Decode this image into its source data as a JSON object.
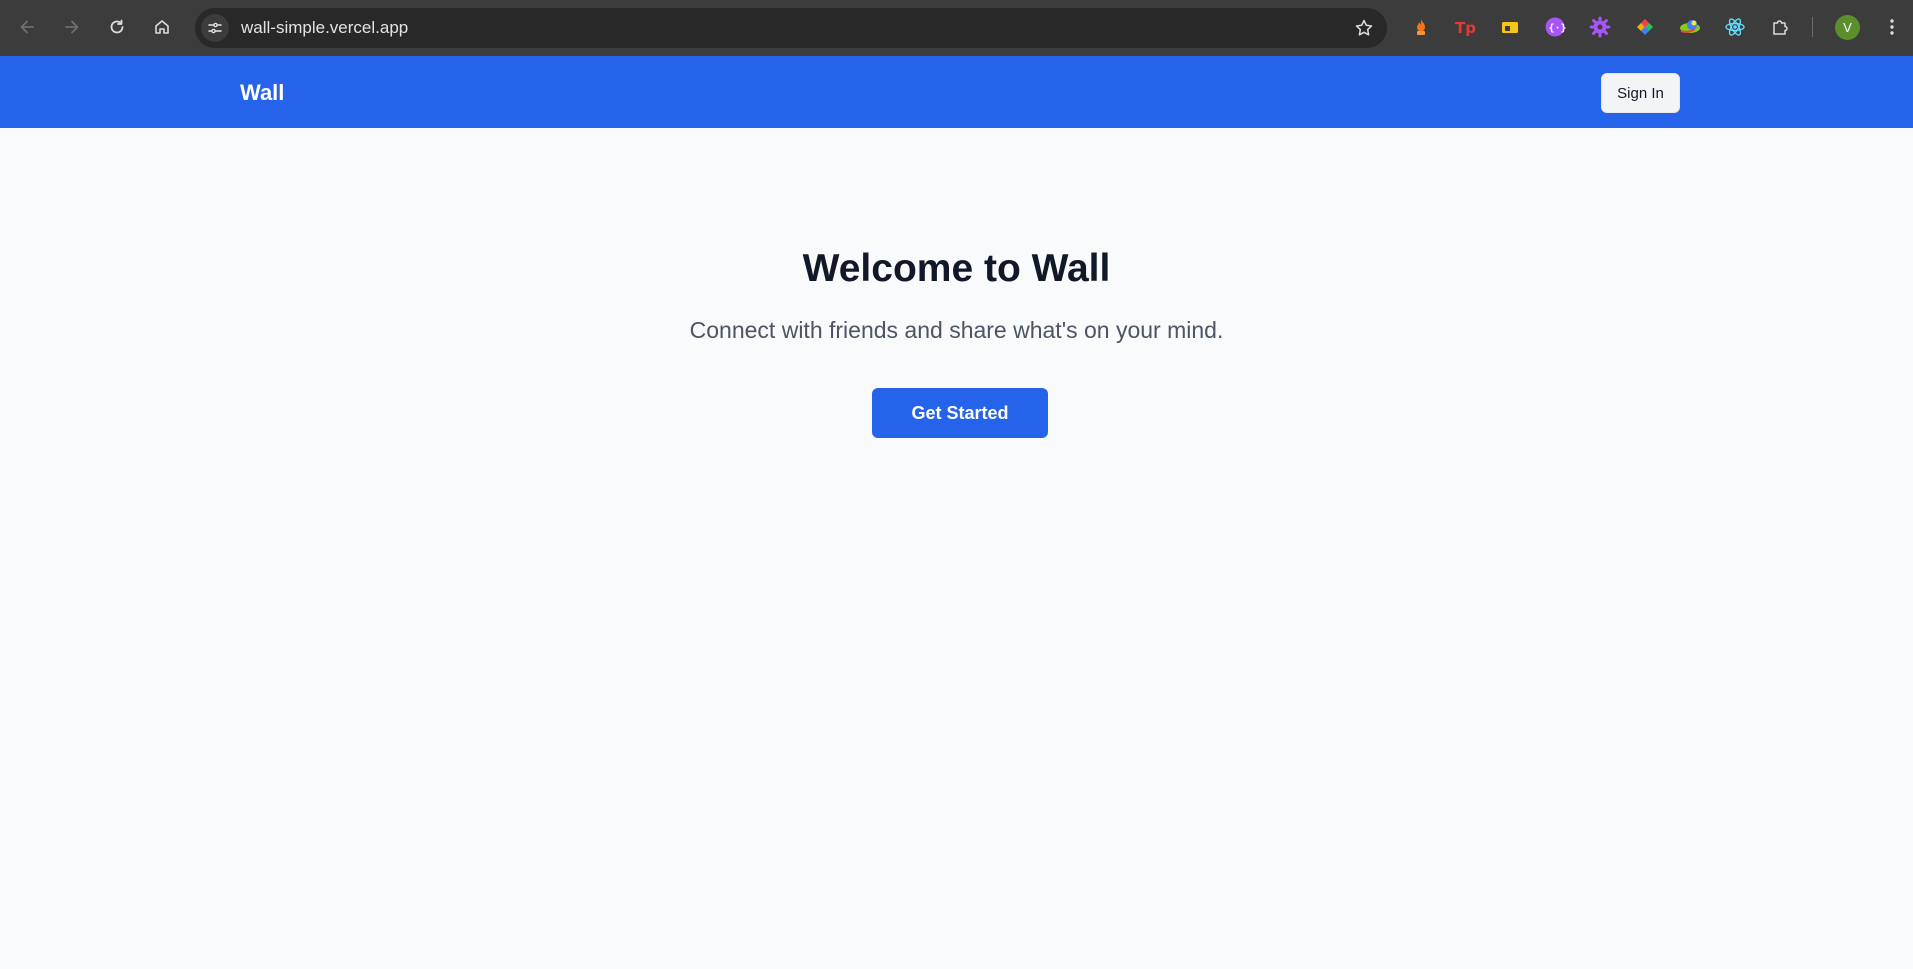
{
  "browser": {
    "url": "wall-simple.vercel.app",
    "profile_initial": "V",
    "icons": {
      "back": "arrow-left-icon",
      "forward": "arrow-right-icon",
      "reload": "reload-icon",
      "home": "home-icon",
      "site_info": "tune-icon",
      "bookmark": "star-icon",
      "extensions_menu": "puzzle-icon",
      "menu": "kebab-icon"
    },
    "extensions": [
      "flame-extension",
      "tp-extension",
      "folder-extension",
      "code-extension",
      "gear-extension",
      "color-picker-extension",
      "eye-dropper-extension",
      "react-devtools-extension"
    ]
  },
  "header": {
    "brand": "Wall",
    "signin_label": "Sign In"
  },
  "hero": {
    "title": "Welcome to Wall",
    "subtitle": "Connect with friends and share what's on your mind.",
    "cta_label": "Get Started"
  },
  "colors": {
    "primary": "#2563eb",
    "background": "#f8fafc",
    "title": "#111827",
    "subtitle": "#4b5563"
  }
}
